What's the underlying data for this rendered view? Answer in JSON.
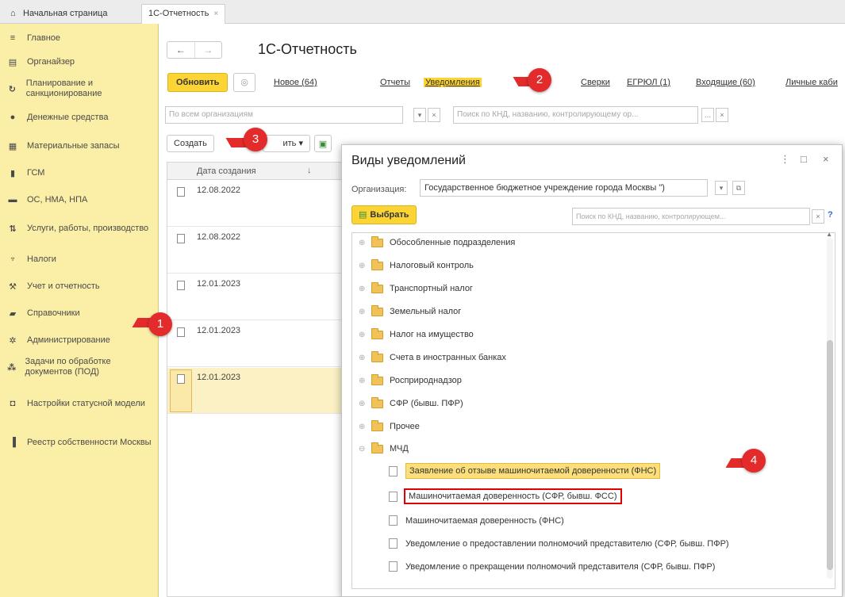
{
  "tabs": {
    "home_label": "Начальная страница",
    "active_label": "1С-Отчетность",
    "close_glyph": "×"
  },
  "sidebar": {
    "items": [
      {
        "label": "Главное",
        "icon": "≡"
      },
      {
        "label": "Органайзер",
        "icon": "▤"
      },
      {
        "label": "Планирование и санкционирование",
        "icon": "↻"
      },
      {
        "label": "Денежные средства",
        "icon": "●"
      },
      {
        "label": "Материальные запасы",
        "icon": "▦"
      },
      {
        "label": "ГСМ",
        "icon": "▮"
      },
      {
        "label": "ОС, НМА, НПА",
        "icon": "▬"
      },
      {
        "label": "Услуги, работы, производство",
        "icon": "⇅"
      },
      {
        "label": "Налоги",
        "icon": "♆"
      },
      {
        "label": "Учет и отчетность",
        "icon": "⚒"
      },
      {
        "label": "Справочники",
        "icon": "▰"
      },
      {
        "label": "Администрирование",
        "icon": "✲"
      },
      {
        "label": "Задачи по обработке документов (ПОД)",
        "icon": "⁂"
      },
      {
        "label": "Настройки статусной модели",
        "icon": "◘"
      },
      {
        "label": "Реестр собственности Москвы",
        "icon": "▐"
      }
    ]
  },
  "main": {
    "title": "1С-Отчетность",
    "back": "←",
    "forward": "→",
    "refresh_label": "Обновить",
    "links": {
      "new": "Новое (64)",
      "reports": "Отчеты",
      "notifications": "Уведомления",
      "reconciliations": "Сверки",
      "egrul": "ЕГРЮЛ (1)",
      "incoming": "Входящие (60)",
      "personal": "Личные каби"
    },
    "org_filter_placeholder": "По всем организациям",
    "search_placeholder": "Поиск по КНД, названию, контролирующему ор...",
    "create_label": "Создать",
    "print_label": "ить",
    "column_date": "Дата создания",
    "rows": [
      {
        "date": "12.08.2022"
      },
      {
        "date": "12.08.2022"
      },
      {
        "date": "12.01.2023"
      },
      {
        "date": "12.01.2023"
      },
      {
        "date": "12.01.2023"
      }
    ]
  },
  "dialog": {
    "title": "Виды уведомлений",
    "org_label": "Организация:",
    "org_value": "Государственное бюджетное учреждение города Москвы \")",
    "select_label": "Выбрать",
    "search_placeholder": "Поиск по КНД, названию, контролирующем...",
    "help": "?",
    "folders": [
      "Обособленные подразделения",
      "Налоговый контроль",
      "Транспортный налог",
      "Земельный налог",
      "Налог на имущество",
      "Счета в иностранных банках",
      "Росприроднадзор",
      "СФР (бывш. ПФР)",
      "Прочее",
      "МЧД"
    ],
    "docs": [
      "Заявление об отзыве машиночитаемой доверенности (ФНС)",
      "Машиночитаемая доверенность (СФР, бывш. ФСС)",
      "Машиночитаемая доверенность (ФНС)",
      "Уведомление о предоставлении полномочий представителю (СФР, бывш. ПФР)",
      "Уведомление о прекращении полномочий представителя (СФР, бывш. ПФР)"
    ]
  },
  "callouts": [
    "1",
    "2",
    "3",
    "4"
  ],
  "colors": {
    "accent": "#fcd535",
    "sidebar": "#fbeea6",
    "callout": "#e32b2b",
    "highlight_box": "#e00000"
  }
}
